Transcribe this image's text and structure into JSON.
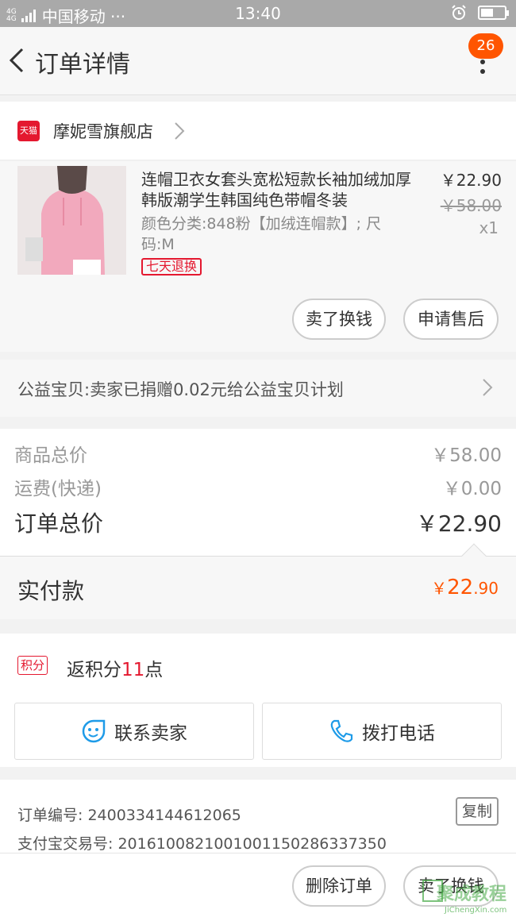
{
  "status_bar": {
    "carrier": "中国移动 ···",
    "net_top": "4G",
    "net_bottom": "4G",
    "time": "13:40",
    "battery_level": 0.55
  },
  "nav": {
    "title": "订单详情",
    "badge": "26"
  },
  "shop": {
    "tmall_label": "天猫",
    "name": "摩妮雪旗舰店"
  },
  "product": {
    "title": "连帽卫衣女套头宽松短款长袖加绒加厚韩版潮学生韩国纯色带帽冬装",
    "sku": "颜色分类:848粉【加绒连帽款】; 尺码:M",
    "tag": "七天退换",
    "price": "￥22.90",
    "original_price": "￥58.00",
    "quantity": "x1",
    "actions": {
      "sell": "卖了换钱",
      "after_sale": "申请售后"
    }
  },
  "charity": {
    "text": "公益宝贝:卖家已捐赠0.02元给公益宝贝计划"
  },
  "summary": {
    "goods_label": "商品总价",
    "goods_value": "￥58.00",
    "shipping_label": "运费(快递)",
    "shipping_value": "￥0.00",
    "total_label": "订单总价",
    "total_value": "￥22.90"
  },
  "paid": {
    "label": "实付款",
    "currency": "￥",
    "int": "22",
    "dec": ".90"
  },
  "points": {
    "tag": "积分",
    "prefix": "返积分",
    "count": "11",
    "suffix": "点"
  },
  "contact": {
    "seller": "联系卖家",
    "call": "拨打电话"
  },
  "info": {
    "order_label": "订单编号:",
    "order_no": "2400334144612065",
    "alipay_label": "支付宝交易号:",
    "alipay_no": "2016100821001001150286337350",
    "copy": "复制"
  },
  "bottom": {
    "delete": "删除订单",
    "sell": "卖了换钱"
  },
  "watermark": {
    "text": "聚成教程",
    "url": "JiChengXin.com"
  },
  "colors": {
    "accent": "#ff5500",
    "tmall_red": "#e4182f",
    "icon_blue": "#1e9be8"
  }
}
